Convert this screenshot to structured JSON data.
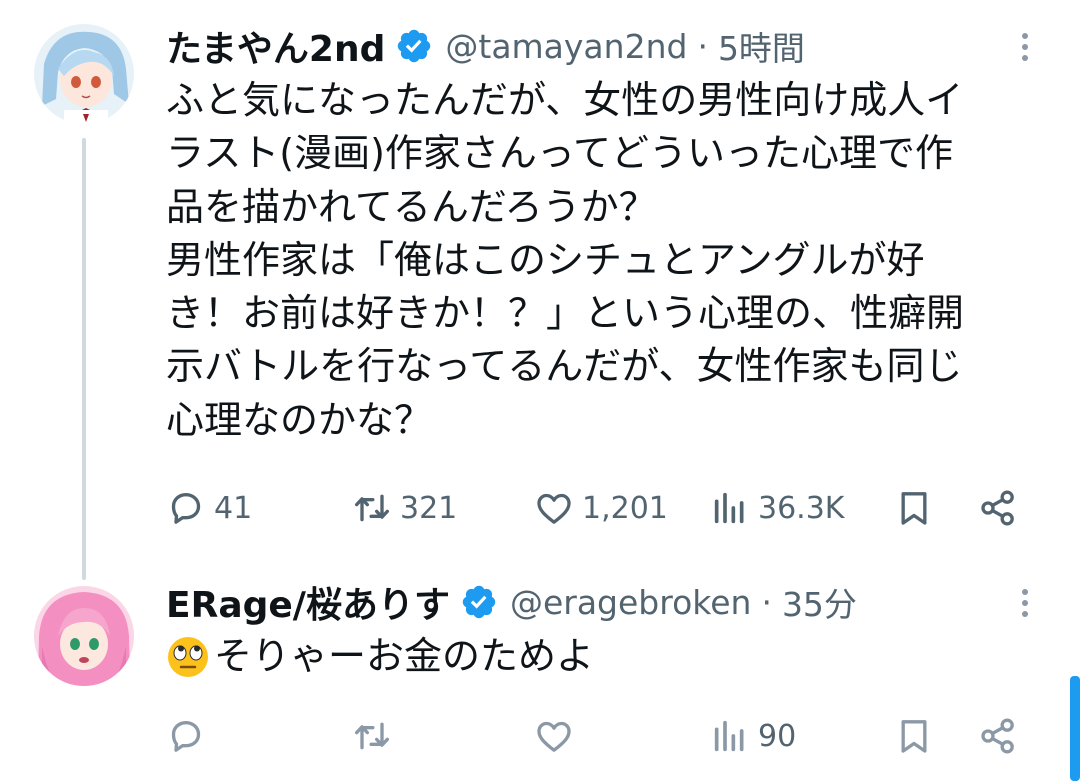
{
  "tweets": [
    {
      "name": "たまやん2nd",
      "handle": "@tamayan2nd",
      "separator": "·",
      "time": "5時間",
      "text": "ふと気になったんだが、女性の男性向け成人イ\nラスト(漫画)作家さんってどういった心理で作\n品を描かれてるんだろうか？\n男性作家は「俺はこのシチュとアングルが好\nき！お前は好きか！？」という心理の、性癖開\n示バトルを行なってるんだが、女性作家も同じ\n心理なのかな？",
      "replies": "41",
      "reposts": "321",
      "likes": "1,201",
      "views": "36.3K"
    },
    {
      "name": "ERage/桜ありす",
      "handle": "@eragebroken",
      "separator": "·",
      "time": "35分",
      "text": "そりゃーお金のためよ",
      "replies": "",
      "reposts": "",
      "likes": "",
      "views": "90"
    }
  ],
  "icons": {
    "verified": "verified-badge-icon",
    "more": "more-options-icon",
    "reply": "reply-icon",
    "repost": "repost-icon",
    "like": "like-icon",
    "views": "views-icon",
    "bookmark": "bookmark-icon",
    "share": "share-icon",
    "emoji": "eye-roll-emoji"
  },
  "colors": {
    "accent": "#1d9bf0",
    "text": "#0f1419",
    "secondary": "#536471",
    "thread_line": "#cfd9de"
  }
}
